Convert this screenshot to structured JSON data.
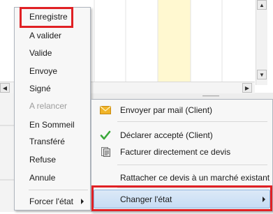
{
  "state_menu": {
    "items": [
      {
        "label": "Enregistre",
        "enabled": true
      },
      {
        "label": "A valider",
        "enabled": true
      },
      {
        "label": "Valide",
        "enabled": true
      },
      {
        "label": "Envoye",
        "enabled": true
      },
      {
        "label": "Signé",
        "enabled": true
      },
      {
        "label": "A relancer",
        "enabled": false
      },
      {
        "label": "En Sommeil",
        "enabled": true
      },
      {
        "label": "Transféré",
        "enabled": true
      },
      {
        "label": "Refuse",
        "enabled": true
      },
      {
        "label": "Annule",
        "enabled": true
      }
    ],
    "force_label": "Forcer l'état"
  },
  "actions_menu": {
    "send_mail": "Envoyer par mail (Client)",
    "declare_accepted": "Déclarer accepté (Client)",
    "invoice_direct": "Facturer directement ce devis",
    "attach_market": "Rattacher ce devis à un marché existant",
    "change_state": "Changer l'état"
  },
  "colors": {
    "highlight_border": "#e02024",
    "check_green": "#3aa83a",
    "mail_yellow": "#f0b429",
    "column_highlight": "#fff8d0"
  }
}
